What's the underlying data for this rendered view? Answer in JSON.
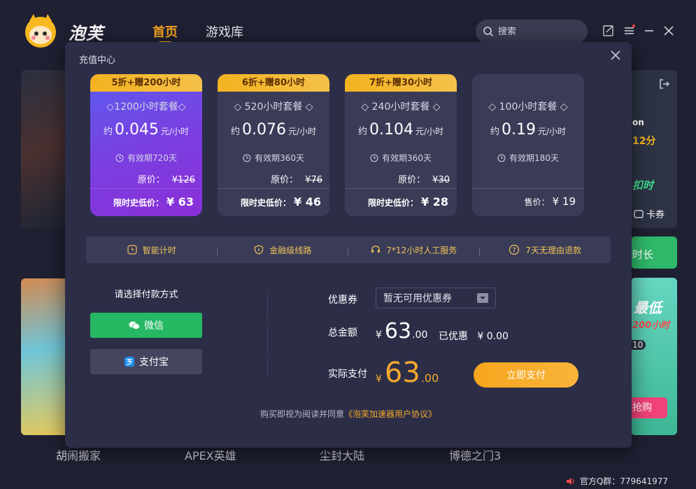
{
  "app": {
    "name": "泡芙",
    "nav": {
      "home": "首页",
      "library": "游戏库"
    },
    "search_placeholder": "搜索"
  },
  "background": {
    "games": [
      "胡闹搬家",
      "APEX英雄",
      "尘封大陆",
      "博德之门3"
    ],
    "qq_group": "官方Q群：779641977",
    "right_banner": {
      "line1": "on",
      "line2": "12分",
      "line3": "扣时",
      "coupon": "卡券",
      "button1": "时长",
      "promo_title": "最低",
      "promo_sub": "200小时",
      "promo_num": "10",
      "promo_btn": "抢购"
    }
  },
  "modal": {
    "title": "充值中心",
    "packages": [
      {
        "badge": "5折+赠200小时",
        "name": "◇1200小时套餐◇",
        "rate_prefix": "约",
        "rate": "0.045",
        "rate_unit": "元/小时",
        "validity": "有效期720天",
        "orig_label": "原价：",
        "orig_price": "¥126",
        "sale_label": "限时史低价：",
        "sale_price": "¥ 63",
        "selected": true
      },
      {
        "badge": "6折+赠80小时",
        "name": "◇ 520小时套餐 ◇",
        "rate_prefix": "约",
        "rate": "0.076",
        "rate_unit": "元/小时",
        "validity": "有效期360天",
        "orig_label": "原价：",
        "orig_price": "¥76",
        "sale_label": "限时史低价：",
        "sale_price": "¥ 46",
        "selected": false
      },
      {
        "badge": "7折+赠30小时",
        "name": "◇ 240小时套餐 ◇",
        "rate_prefix": "约",
        "rate": "0.104",
        "rate_unit": "元/小时",
        "validity": "有效期360天",
        "orig_label": "原价：",
        "orig_price": "¥30",
        "sale_label": "限时史低价：",
        "sale_price": "¥ 28",
        "selected": false
      },
      {
        "badge": "",
        "name": "◇ 100小时套餐 ◇",
        "rate_prefix": "约",
        "rate": "0.19",
        "rate_unit": "元/小时",
        "validity": "有效期180天",
        "orig_label": "",
        "orig_price": "",
        "sale_label": "售价：",
        "sale_price": "¥ 19",
        "selected": false
      }
    ],
    "features": [
      "智能计时",
      "金融级线路",
      "7*12小时人工服务",
      "7天无理由退款"
    ],
    "payment": {
      "method_label": "请选择付款方式",
      "wechat": "微信",
      "alipay": "支付宝"
    },
    "coupon": {
      "label": "优惠券",
      "value": "暂无可用优惠券"
    },
    "total": {
      "label": "总金额",
      "currency": "¥",
      "int": "63",
      "dec": ".00"
    },
    "discount": {
      "label": "已优惠",
      "value": "¥ 0.00"
    },
    "actual": {
      "label": "实际支付",
      "currency": "¥",
      "int": "63",
      "dec": ".00"
    },
    "pay_now": "立即支付",
    "agreement_text": "购买即视为阅读并同意",
    "agreement_link": "《泡芙加速器用户协议》"
  },
  "colors": {
    "accent": "#f7a51e",
    "wechat": "#26b863",
    "modal_bg": "#2c2e48"
  }
}
